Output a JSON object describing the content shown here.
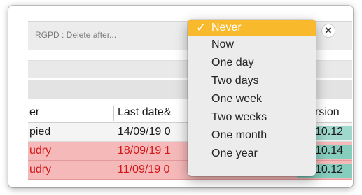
{
  "field": {
    "label": "RGPD : Delete after...",
    "clear_symbol": "✕"
  },
  "table": {
    "headers": [
      "er",
      "Last date&",
      "rsion"
    ],
    "rows": [
      {
        "c1": "pied",
        "c2": "14/09/19 0",
        "c3": "10.12",
        "status": "normal"
      },
      {
        "c1": "udry",
        "c2": "18/09/19 1",
        "c3": "10.14",
        "status": "error"
      },
      {
        "c1": "udry",
        "c2": "11/09/19 0",
        "c3": "10.12",
        "status": "error"
      }
    ]
  },
  "menu": {
    "check_symbol": "✓",
    "selected_index": 0,
    "items": [
      "Never",
      "Now",
      "One day",
      "Two days",
      "One week",
      "Two weeks",
      "One month",
      "One year"
    ]
  },
  "colors": {
    "selected_item": "#f9b92c",
    "error_row": "#f6b9b9",
    "error_text": "#d21818",
    "version_cell": "#9fd8cc"
  }
}
